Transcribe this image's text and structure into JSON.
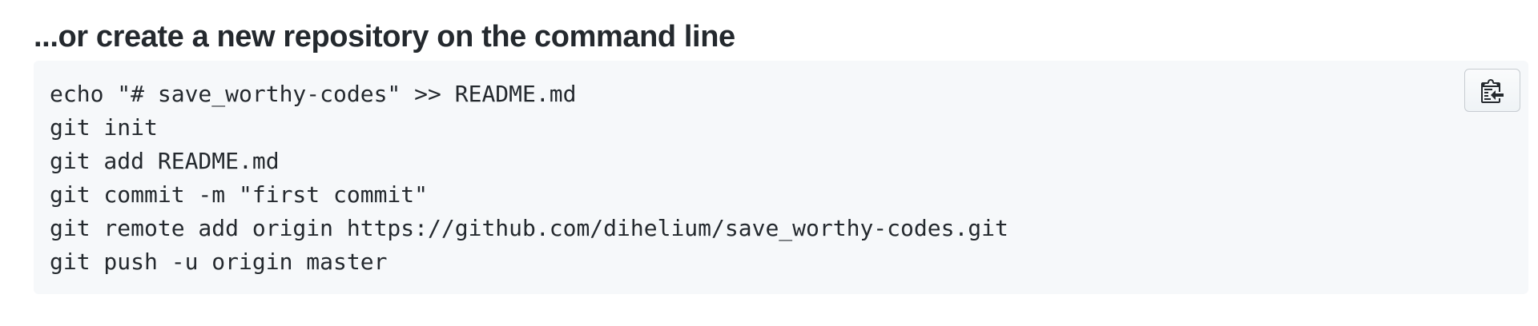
{
  "heading": "...or create a new repository on the command line",
  "code_lines": [
    "echo \"# save_worthy-codes\" >> README.md",
    "git init",
    "git add README.md",
    "git commit -m \"first commit\"",
    "git remote add origin https://github.com/dihelium/save_worthy-codes.git",
    "git push -u origin master"
  ],
  "copy_button": {
    "icon": "clipboard-icon"
  }
}
